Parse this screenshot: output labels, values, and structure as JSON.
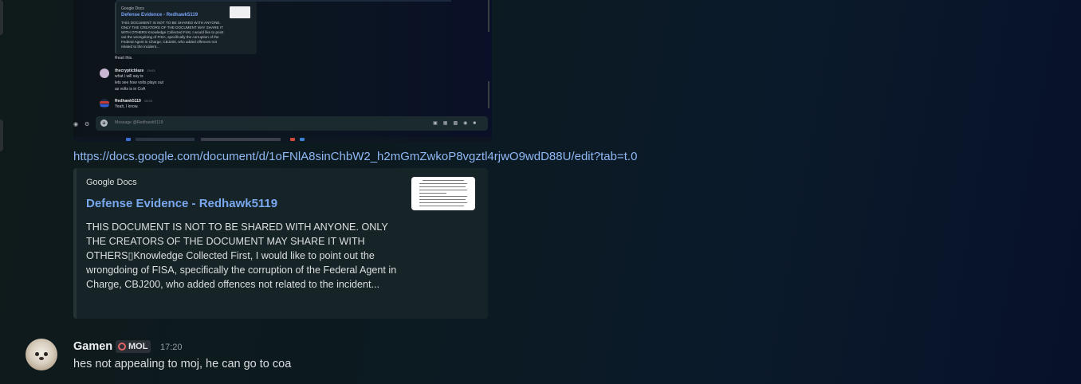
{
  "screenshot_embed": {
    "mini_source": "Google Docs",
    "mini_title": "Defense Evidence - Redhawk5119",
    "mini_desc": "THIS DOCUMENT IS NOT TO BE SHARED WITH ANYONE. ONLY THE CREATORS OF THE DOCUMENT MAY SHARE IT WITH OTHERS Knowledge Collected First, I would like to point out the wrongdoing of FISA, specifically the corruption of the Federal Agent in Charge, CBJ200, who added offences not related to the incident...",
    "messages": [
      {
        "name": "",
        "time": "",
        "lines": [
          "Read this."
        ]
      },
      {
        "name": "thecrypticblaze",
        "time": "19:03",
        "lines": [
          "what i will say is",
          "lets see how volts plays out",
          "as volts is in CoA"
        ]
      },
      {
        "name": "Redhawk5119",
        "time": "19:03",
        "lines": [
          "Yeah, I know."
        ]
      }
    ],
    "composer_placeholder": "Message @Redhawk5119"
  },
  "link": {
    "url": "https://docs.google.com/document/d/1oFNlA8sinChbW2_h2mGmZwkoP8vgztl4rjwO9wdD88U/edit?tab=t.0"
  },
  "embed": {
    "source": "Google Docs",
    "title": "Defense Evidence - Redhawk5119",
    "description": "THIS DOCUMENT IS NOT TO BE SHARED WITH ANYONE. ONLY THE CREATORS OF THE DOCUMENT MAY SHARE IT WITH OTHERS▯Knowledge Collected First, I would like to point out the wrongdoing of FISA, specifically the corruption of the Federal Agent in Charge, CBJ200, who added offences not related to the incident..."
  },
  "message": {
    "username": "Gamen",
    "tag": "MOL",
    "timestamp": "17:20",
    "text": "hes not appealing to moj, he can go to coa"
  },
  "colors": {
    "link": "#8fb8f5",
    "embed_title": "#79a8ef",
    "tag_icon": "#e26565"
  }
}
